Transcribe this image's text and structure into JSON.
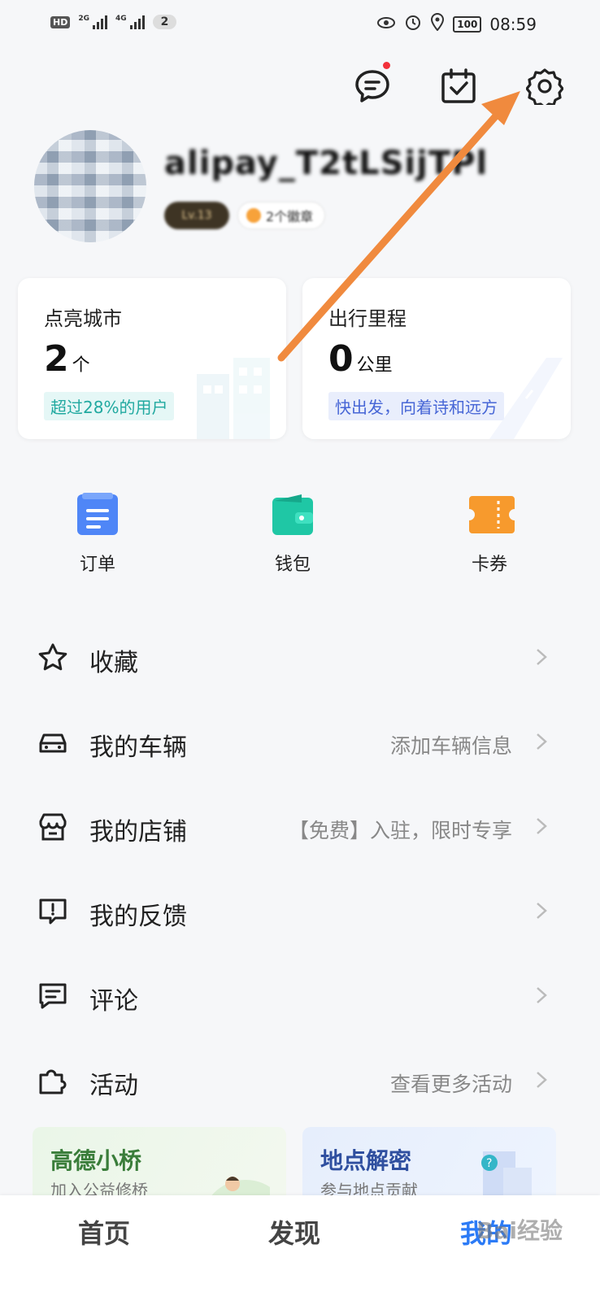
{
  "status_bar": {
    "hd": "HD",
    "net1": "2G",
    "net2": "4G",
    "notif_count": "2",
    "battery": "100",
    "time": "08:59"
  },
  "header": {
    "icons": [
      "message-icon",
      "checkin-calendar-icon",
      "settings-gear-icon"
    ],
    "message_has_dot": true
  },
  "profile": {
    "username": "alipay_T2tLSijTPl",
    "level_badge": "Lv.13",
    "medal_text": "2个徽章"
  },
  "stats": [
    {
      "title": "点亮城市",
      "value": "2",
      "unit": "个",
      "tag": "超过28%的用户"
    },
    {
      "title": "出行里程",
      "value": "0",
      "unit": "公里",
      "tag": "快出发，向着诗和远方"
    }
  ],
  "quick_actions": [
    {
      "label": "订单",
      "icon": "order-icon",
      "color": "#4f86f7"
    },
    {
      "label": "钱包",
      "icon": "wallet-icon",
      "color": "#1fc7a5"
    },
    {
      "label": "卡券",
      "icon": "coupon-icon",
      "color": "#f79a2d"
    }
  ],
  "menu": [
    {
      "label": "收藏",
      "hint": "",
      "icon": "star-icon"
    },
    {
      "label": "我的车辆",
      "hint": "添加车辆信息",
      "icon": "car-icon"
    },
    {
      "label": "我的店铺",
      "hint": "【免费】入驻，限时专享",
      "icon": "store-icon"
    },
    {
      "label": "我的反馈",
      "hint": "",
      "icon": "feedback-icon"
    },
    {
      "label": "评论",
      "hint": "",
      "icon": "comment-icon"
    },
    {
      "label": "活动",
      "hint": "查看更多活动",
      "icon": "puzzle-icon"
    }
  ],
  "promos": [
    {
      "title": "高德小桥",
      "subtitle": "加入公益修桥"
    },
    {
      "title": "地点解密",
      "subtitle": "参与地点贡献"
    }
  ],
  "tabs": [
    {
      "label": "首页",
      "active": false
    },
    {
      "label": "发现",
      "active": false
    },
    {
      "label": "我的",
      "active": true
    }
  ],
  "watermark": "Bai经验",
  "colors": {
    "accent": "#2c7bf6",
    "annotation_arrow": "#f08a3e"
  }
}
